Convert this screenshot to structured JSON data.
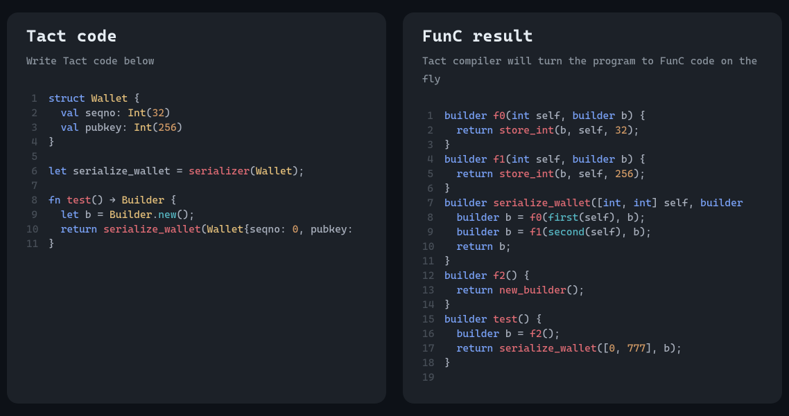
{
  "left": {
    "title": "Tact code",
    "subtitle": "Write Tact code below",
    "lines": [
      [
        {
          "t": "kw",
          "v": "struct"
        },
        {
          "t": "id",
          "v": " "
        },
        {
          "t": "type",
          "v": "Wallet"
        },
        {
          "t": "punc",
          "v": " {"
        }
      ],
      [
        {
          "t": "id",
          "v": "  "
        },
        {
          "t": "kw",
          "v": "val"
        },
        {
          "t": "id",
          "v": " seqno: "
        },
        {
          "t": "type",
          "v": "Int"
        },
        {
          "t": "punc",
          "v": "("
        },
        {
          "t": "num",
          "v": "32"
        },
        {
          "t": "punc",
          "v": ")"
        }
      ],
      [
        {
          "t": "id",
          "v": "  "
        },
        {
          "t": "kw",
          "v": "val"
        },
        {
          "t": "id",
          "v": " pubkey: "
        },
        {
          "t": "type",
          "v": "Int"
        },
        {
          "t": "punc",
          "v": "("
        },
        {
          "t": "num",
          "v": "256"
        },
        {
          "t": "punc",
          "v": ")"
        }
      ],
      [
        {
          "t": "punc",
          "v": "}"
        }
      ],
      [
        {
          "t": "id",
          "v": ""
        }
      ],
      [
        {
          "t": "kw",
          "v": "let"
        },
        {
          "t": "id",
          "v": " serialize_wallet = "
        },
        {
          "t": "fn",
          "v": "serializer"
        },
        {
          "t": "punc",
          "v": "("
        },
        {
          "t": "type",
          "v": "Wallet"
        },
        {
          "t": "punc",
          "v": ");"
        }
      ],
      [
        {
          "t": "id",
          "v": ""
        }
      ],
      [
        {
          "t": "kw",
          "v": "fn"
        },
        {
          "t": "id",
          "v": " "
        },
        {
          "t": "fn",
          "v": "test"
        },
        {
          "t": "punc",
          "v": "() → "
        },
        {
          "t": "type",
          "v": "Builder"
        },
        {
          "t": "punc",
          "v": " {"
        }
      ],
      [
        {
          "t": "id",
          "v": "  "
        },
        {
          "t": "kw",
          "v": "let"
        },
        {
          "t": "id",
          "v": " b = "
        },
        {
          "t": "type",
          "v": "Builder"
        },
        {
          "t": "punc",
          "v": "."
        },
        {
          "t": "fn2",
          "v": "new"
        },
        {
          "t": "punc",
          "v": "();"
        }
      ],
      [
        {
          "t": "id",
          "v": "  "
        },
        {
          "t": "kw",
          "v": "return"
        },
        {
          "t": "id",
          "v": " "
        },
        {
          "t": "fn",
          "v": "serialize_wallet"
        },
        {
          "t": "punc",
          "v": "("
        },
        {
          "t": "type",
          "v": "Wallet"
        },
        {
          "t": "punc",
          "v": "{seqno: "
        },
        {
          "t": "num",
          "v": "0"
        },
        {
          "t": "punc",
          "v": ", pubkey: "
        }
      ],
      [
        {
          "t": "punc",
          "v": "}"
        }
      ]
    ]
  },
  "right": {
    "title": "FunC result",
    "subtitle": "Tact compiler will turn the program\nto FunC code on the fly",
    "lines": [
      [
        {
          "t": "kw",
          "v": "builder"
        },
        {
          "t": "id",
          "v": " "
        },
        {
          "t": "fn",
          "v": "f0"
        },
        {
          "t": "punc",
          "v": "("
        },
        {
          "t": "kw",
          "v": "int"
        },
        {
          "t": "id",
          "v": " self, "
        },
        {
          "t": "kw",
          "v": "builder"
        },
        {
          "t": "id",
          "v": " b"
        },
        {
          "t": "punc",
          "v": ") {"
        }
      ],
      [
        {
          "t": "id",
          "v": "  "
        },
        {
          "t": "kw",
          "v": "return"
        },
        {
          "t": "id",
          "v": " "
        },
        {
          "t": "fn",
          "v": "store_int"
        },
        {
          "t": "punc",
          "v": "(b, self, "
        },
        {
          "t": "num",
          "v": "32"
        },
        {
          "t": "punc",
          "v": ");"
        }
      ],
      [
        {
          "t": "punc",
          "v": "}"
        }
      ],
      [
        {
          "t": "kw",
          "v": "builder"
        },
        {
          "t": "id",
          "v": " "
        },
        {
          "t": "fn",
          "v": "f1"
        },
        {
          "t": "punc",
          "v": "("
        },
        {
          "t": "kw",
          "v": "int"
        },
        {
          "t": "id",
          "v": " self, "
        },
        {
          "t": "kw",
          "v": "builder"
        },
        {
          "t": "id",
          "v": " b"
        },
        {
          "t": "punc",
          "v": ") {"
        }
      ],
      [
        {
          "t": "id",
          "v": "  "
        },
        {
          "t": "kw",
          "v": "return"
        },
        {
          "t": "id",
          "v": " "
        },
        {
          "t": "fn",
          "v": "store_int"
        },
        {
          "t": "punc",
          "v": "(b, self, "
        },
        {
          "t": "num",
          "v": "256"
        },
        {
          "t": "punc",
          "v": ");"
        }
      ],
      [
        {
          "t": "punc",
          "v": "}"
        }
      ],
      [
        {
          "t": "kw",
          "v": "builder"
        },
        {
          "t": "id",
          "v": " "
        },
        {
          "t": "fn",
          "v": "serialize_wallet"
        },
        {
          "t": "punc",
          "v": "(["
        },
        {
          "t": "kw",
          "v": "int"
        },
        {
          "t": "punc",
          "v": ", "
        },
        {
          "t": "kw",
          "v": "int"
        },
        {
          "t": "punc",
          "v": "] self, "
        },
        {
          "t": "kw",
          "v": "builder"
        },
        {
          "t": "id",
          "v": " "
        }
      ],
      [
        {
          "t": "id",
          "v": "  "
        },
        {
          "t": "kw",
          "v": "builder"
        },
        {
          "t": "id",
          "v": " b = "
        },
        {
          "t": "fn",
          "v": "f0"
        },
        {
          "t": "punc",
          "v": "("
        },
        {
          "t": "fn2",
          "v": "first"
        },
        {
          "t": "punc",
          "v": "(self), b);"
        }
      ],
      [
        {
          "t": "id",
          "v": "  "
        },
        {
          "t": "kw",
          "v": "builder"
        },
        {
          "t": "id",
          "v": " b = "
        },
        {
          "t": "fn",
          "v": "f1"
        },
        {
          "t": "punc",
          "v": "("
        },
        {
          "t": "fn2",
          "v": "second"
        },
        {
          "t": "punc",
          "v": "(self), b);"
        }
      ],
      [
        {
          "t": "id",
          "v": "  "
        },
        {
          "t": "kw",
          "v": "return"
        },
        {
          "t": "id",
          "v": " b;"
        }
      ],
      [
        {
          "t": "punc",
          "v": "}"
        }
      ],
      [
        {
          "t": "kw",
          "v": "builder"
        },
        {
          "t": "id",
          "v": " "
        },
        {
          "t": "fn",
          "v": "f2"
        },
        {
          "t": "punc",
          "v": "() {"
        }
      ],
      [
        {
          "t": "id",
          "v": "  "
        },
        {
          "t": "kw",
          "v": "return"
        },
        {
          "t": "id",
          "v": " "
        },
        {
          "t": "fn",
          "v": "new_builder"
        },
        {
          "t": "punc",
          "v": "();"
        }
      ],
      [
        {
          "t": "punc",
          "v": "}"
        }
      ],
      [
        {
          "t": "kw",
          "v": "builder"
        },
        {
          "t": "id",
          "v": " "
        },
        {
          "t": "fn",
          "v": "test"
        },
        {
          "t": "punc",
          "v": "() {"
        }
      ],
      [
        {
          "t": "id",
          "v": "  "
        },
        {
          "t": "kw",
          "v": "builder"
        },
        {
          "t": "id",
          "v": " b = "
        },
        {
          "t": "fn",
          "v": "f2"
        },
        {
          "t": "punc",
          "v": "();"
        }
      ],
      [
        {
          "t": "id",
          "v": "  "
        },
        {
          "t": "kw",
          "v": "return"
        },
        {
          "t": "id",
          "v": " "
        },
        {
          "t": "fn",
          "v": "serialize_wallet"
        },
        {
          "t": "punc",
          "v": "(["
        },
        {
          "t": "num",
          "v": "0"
        },
        {
          "t": "punc",
          "v": ", "
        },
        {
          "t": "num",
          "v": "777"
        },
        {
          "t": "punc",
          "v": "], b);"
        }
      ],
      [
        {
          "t": "punc",
          "v": "}"
        }
      ],
      [
        {
          "t": "id",
          "v": ""
        }
      ]
    ]
  }
}
